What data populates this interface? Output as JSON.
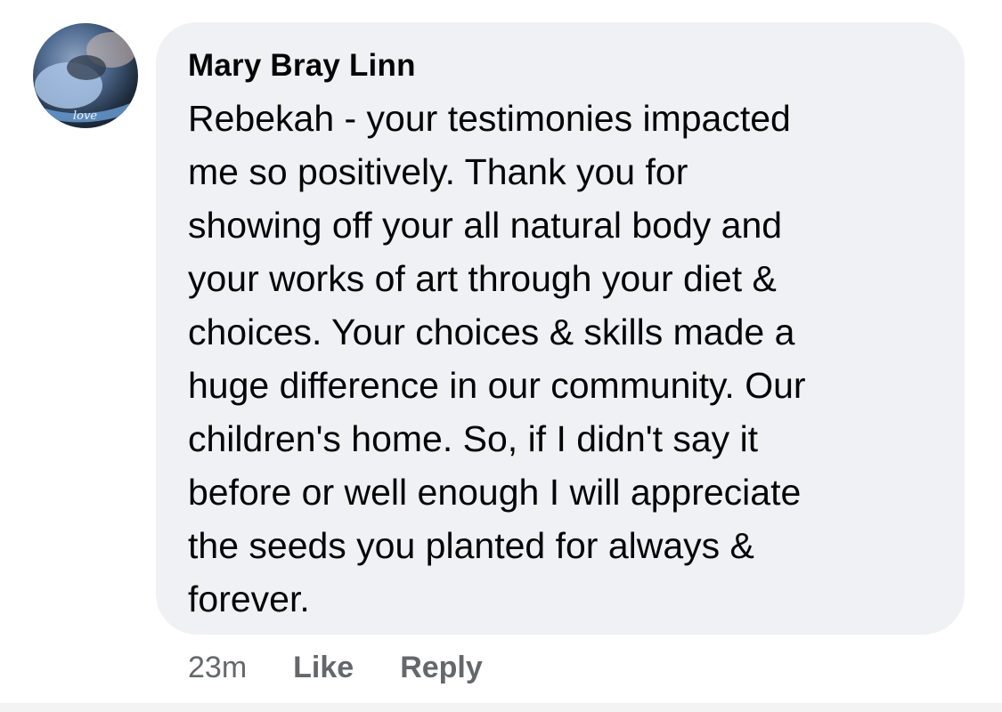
{
  "comment": {
    "author": "Mary Bray Linn",
    "text": "Rebekah - your testimonies impacted\nme so positively. Thank you for\nshowing off your all natural body and\nyour works of art through your diet &\nchoices. Your choices & skills made a\nhuge difference in our community. Our\nchildren's home. So, if I didn't say it\nbefore or well enough I will appreciate\nthe seeds you planted for always &\nforever.",
    "avatar_overlay_text": "love",
    "timestamp": "23m",
    "like_label": "Like",
    "reply_label": "Reply"
  },
  "colors": {
    "bubble_background": "#f0f1f5",
    "primary_text": "#050505",
    "secondary_text": "#65676b"
  }
}
